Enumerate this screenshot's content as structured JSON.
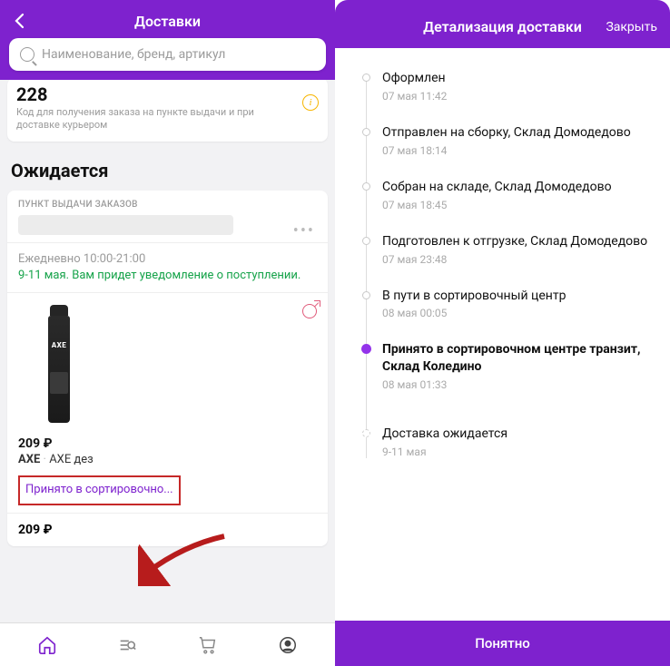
{
  "left": {
    "header": {
      "title": "Доставки",
      "search_placeholder": "Наименование, бренд, артикул"
    },
    "code_card": {
      "code": "228",
      "subtitle": "Код для получения заказа на пункте выдачи и при доставке курьером"
    },
    "section_title": "Ожидается",
    "order": {
      "pickup_label": "ПУНКТ ВЫДАЧИ ЗАКАЗОВ",
      "schedule": "Ежедневно 10:00-21:00",
      "eta": "9-11 мая. Вам придет уведомление о поступлении.",
      "price": "209 ₽",
      "brand": "AXE",
      "name": "AXE дез",
      "status": "Принято в сортировочно...",
      "total": "209 ₽",
      "dots": "•••"
    }
  },
  "right": {
    "header": {
      "title": "Детализация доставки",
      "close": "Закрыть"
    },
    "timeline": [
      {
        "title": "Оформлен",
        "time": "07 мая 11:42",
        "state": "past"
      },
      {
        "title": "Отправлен на сборку, Склад Домодедово",
        "time": "07 мая 18:14",
        "state": "past"
      },
      {
        "title": "Собран на складе, Склад Домодедово",
        "time": "07 мая 18:45",
        "state": "past"
      },
      {
        "title": "Подготовлен к отгрузке, Склад Домодедово",
        "time": "07 мая 23:48",
        "state": "past"
      },
      {
        "title": "В пути в сортировочный центр",
        "time": "08 мая 00:05",
        "state": "past"
      },
      {
        "title": "Принято в сортировочном центре транзит, Склад Коледино",
        "time": "08 мая 01:33",
        "state": "active"
      },
      {
        "title": "Доставка ожидается",
        "time": "9-11 мая",
        "state": "future"
      }
    ],
    "footer_button": "Понятно"
  }
}
